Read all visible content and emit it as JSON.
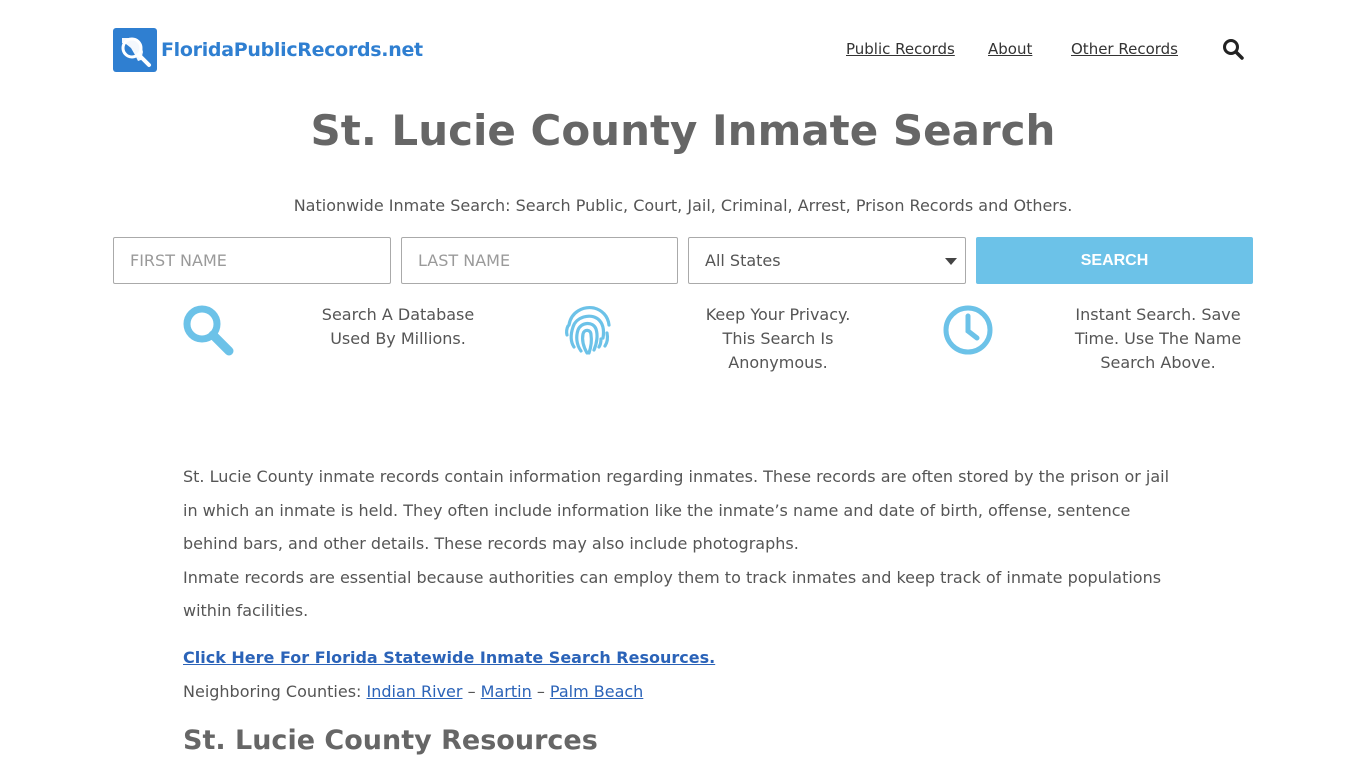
{
  "header": {
    "logo_text": "FloridaPublicRecords.net",
    "nav": [
      "Public Records",
      "About",
      "Other Records"
    ]
  },
  "main": {
    "title": "St. Lucie County Inmate Search",
    "subtitle": "Nationwide Inmate Search: Search Public, Court, Jail, Criminal, Arrest, Prison Records and Others."
  },
  "search_form": {
    "first_name_placeholder": "FIRST NAME",
    "last_name_placeholder": "LAST NAME",
    "state_selected": "All States",
    "button_label": "SEARCH"
  },
  "features": [
    {
      "icon": "search-icon",
      "lines": [
        "Search A Database",
        "Used By Millions."
      ]
    },
    {
      "icon": "fingerprint-icon",
      "lines": [
        "Keep Your Privacy.",
        "This Search Is",
        "Anonymous."
      ]
    },
    {
      "icon": "clock-icon",
      "lines": [
        "Instant Search. Save",
        "Time. Use The Name",
        "Search Above."
      ]
    }
  ],
  "content": {
    "paragraph_1": "St. Lucie County inmate records contain information regarding inmates. These records are often stored by the prison or jail in which an inmate is held. They often include information like the inmate’s name and date of birth, offense, sentence behind bars, and other details. These records may also include photographs.",
    "paragraph_2": "Inmate records are essential because authorities can employ them to track inmates and keep track of inmate populations within facilities.",
    "resources_link": "Click Here For Florida Statewide Inmate Search Resources.",
    "neighbors_label": "Neighboring Counties:",
    "neighbors": [
      "Indian River",
      "Martin",
      "Palm Beach"
    ],
    "separator": "–",
    "section_title": "St. Lucie County Resources"
  },
  "colors": {
    "brand_blue": "#2f7fd1",
    "button_blue": "#6cc2e8",
    "icon_blue": "#6cc2e8",
    "link_blue": "#2b63b8"
  }
}
